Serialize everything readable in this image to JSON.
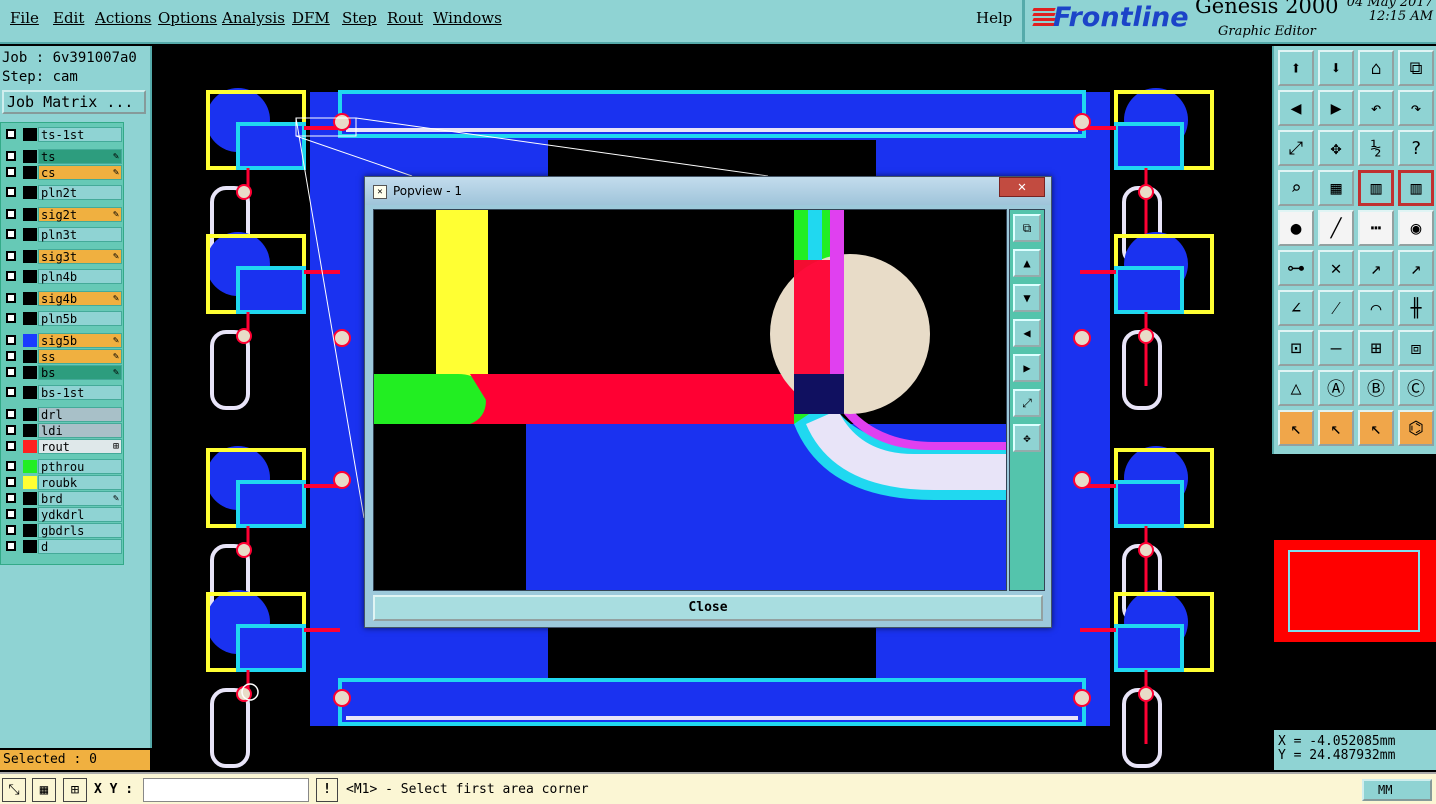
{
  "menu": [
    "File",
    "Edit",
    "Actions",
    "Options",
    "Analysis",
    "DFM",
    "Step",
    "Rout",
    "Windows"
  ],
  "help": "Help",
  "brand": {
    "logo": "Frontline",
    "product": "Genesis 2000",
    "subtitle": "Graphic Editor",
    "date": "04 May 2017",
    "time": "12:15 AM"
  },
  "job": {
    "job_line": "Job : 6v391007a0",
    "step_line": "Step: cam",
    "matrix_button": "Job Matrix ..."
  },
  "layers": [
    {
      "name": "ts-1st",
      "color": "",
      "bg": "#8fd3d3",
      "mark": ""
    },
    {
      "name": "ts",
      "color": "",
      "bg": "#2d9d7e",
      "mark": "✎"
    },
    {
      "name": "cs",
      "color": "",
      "bg": "#f0b040",
      "mark": "✎"
    },
    {
      "name": "pln2t",
      "color": "",
      "bg": "#8fd3d3",
      "mark": ""
    },
    {
      "name": "sig2t",
      "color": "",
      "bg": "#f0b040",
      "mark": "✎"
    },
    {
      "name": "pln3t",
      "color": "",
      "bg": "#8fd3d3",
      "mark": ""
    },
    {
      "name": "sig3t",
      "color": "",
      "bg": "#f0b040",
      "mark": "✎"
    },
    {
      "name": "pln4b",
      "color": "",
      "bg": "#8fd3d3",
      "mark": ""
    },
    {
      "name": "sig4b",
      "color": "",
      "bg": "#f0b040",
      "mark": "✎"
    },
    {
      "name": "pln5b",
      "color": "",
      "bg": "#8fd3d3",
      "mark": ""
    },
    {
      "name": "sig5b",
      "color": "#1a3cff",
      "bg": "#f0b040",
      "mark": "✎"
    },
    {
      "name": "ss",
      "color": "",
      "bg": "#f0b040",
      "mark": "✎"
    },
    {
      "name": "bs",
      "color": "",
      "bg": "#2d9d7e",
      "mark": "✎"
    },
    {
      "name": "bs-1st",
      "color": "",
      "bg": "#8fd3d3",
      "mark": ""
    },
    {
      "name": "drl",
      "color": "",
      "bg": "#a8c0c8",
      "mark": ""
    },
    {
      "name": "ldi",
      "color": "",
      "bg": "#a8c0c8",
      "mark": ""
    },
    {
      "name": "rout",
      "color": "#ff2020",
      "bg": "#dfe8ea",
      "mark": "⊞"
    },
    {
      "name": "pthrou",
      "color": "#22ee22",
      "bg": "#8fd3d3",
      "mark": ""
    },
    {
      "name": "roubk",
      "color": "#ffff33",
      "bg": "#8fd3d3",
      "mark": ""
    },
    {
      "name": "brd",
      "color": "",
      "bg": "#8fd3d3",
      "mark": "✎"
    },
    {
      "name": "ydkdrl",
      "color": "",
      "bg": "#8fd3d3",
      "mark": ""
    },
    {
      "name": "gbdrls",
      "color": "",
      "bg": "#8fd3d3",
      "mark": ""
    },
    {
      "name": "d",
      "color": "",
      "bg": "#8fd3d3",
      "mark": ""
    }
  ],
  "selected": "Selected : 0",
  "status": {
    "xy_label": "X Y :",
    "xy_value": "",
    "warn": "!",
    "prompt": "<M1> - Select first area corner",
    "units": "MM"
  },
  "coords": {
    "x": "X = -4.052085mm",
    "y": "Y = 24.487932mm"
  },
  "popview": {
    "title": "Popview - 1",
    "close_label": "Close"
  },
  "colors": {
    "board": "#1a32f0",
    "rout": "#ff0033",
    "roubk": "#ffff33",
    "pthrou": "#22ee22",
    "outline": "#20d8f0",
    "pad_fill": "#e8dcc8",
    "panel": "#8fd3d3"
  }
}
